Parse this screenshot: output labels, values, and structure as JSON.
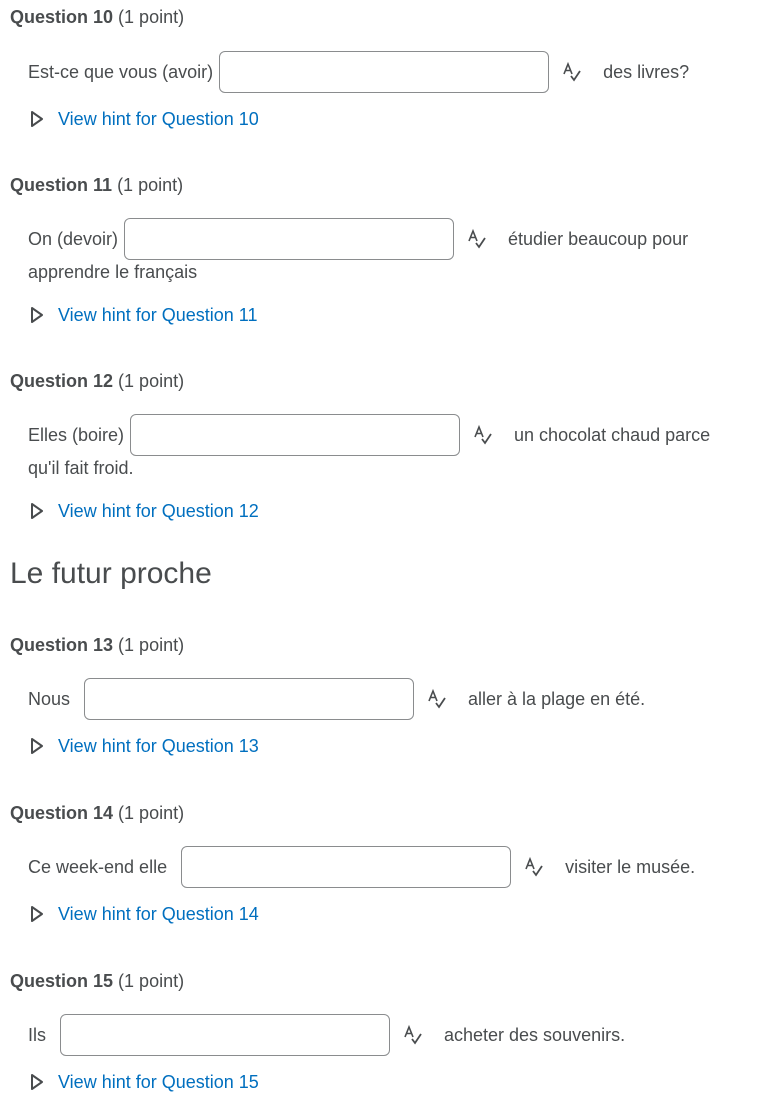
{
  "questions": [
    {
      "number_label": "Question 10",
      "points_label": "(1 point)",
      "before": "Est-ce que vous (avoir)",
      "answer_value": "",
      "after": "des livres?",
      "continuation": "",
      "hint_label": "View hint for Question 10"
    },
    {
      "number_label": "Question 11",
      "points_label": "(1 point)",
      "before": "On (devoir)",
      "answer_value": "",
      "after": "étudier beaucoup pour",
      "continuation": "apprendre le français",
      "hint_label": "View hint for Question 11"
    },
    {
      "number_label": "Question 12",
      "points_label": "(1 point)",
      "before": "Elles (boire)",
      "answer_value": "",
      "after": "un chocolat chaud parce",
      "continuation": "qu'il fait froid.",
      "hint_label": "View hint for Question 12"
    },
    {
      "number_label": "Question 13",
      "points_label": "(1 point)",
      "before": "Nous",
      "answer_value": "",
      "after": "aller à la plage en été.",
      "continuation": "",
      "hint_label": "View hint for Question 13"
    },
    {
      "number_label": "Question 14",
      "points_label": "(1 point)",
      "before": "Ce week-end elle",
      "answer_value": "",
      "after": "visiter le musée.",
      "continuation": "",
      "hint_label": "View hint for Question 14"
    },
    {
      "number_label": "Question 15",
      "points_label": "(1 point)",
      "before": "Ils",
      "answer_value": "",
      "after": "acheter des souvenirs.",
      "continuation": "",
      "hint_label": "View hint for Question 15"
    }
  ],
  "section": {
    "title": "Le futur proche"
  },
  "icons": {
    "spellcheck": "spellcheck-icon",
    "hint_toggle": "triangle-right-icon"
  },
  "colors": {
    "link": "#006fbf",
    "text": "#494c4e",
    "border": "#8a8c8e"
  }
}
